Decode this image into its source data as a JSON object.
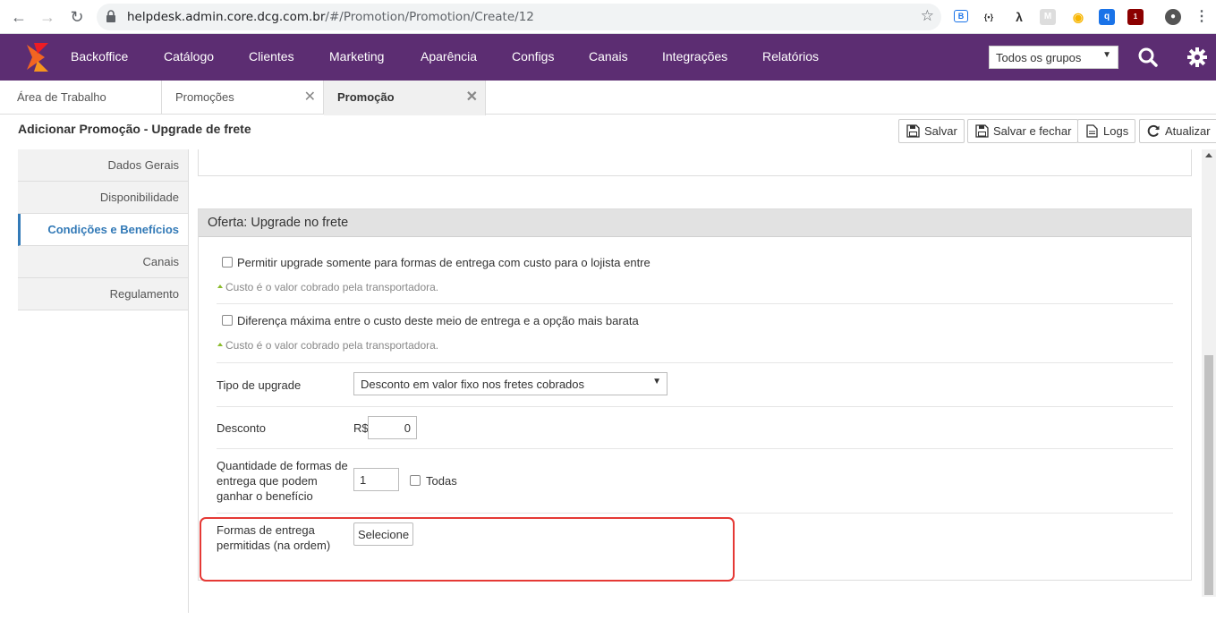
{
  "browser": {
    "url_host": "helpdesk.admin.core.dcg.com.br",
    "url_path": "/#/Promotion/Promotion/Create/12",
    "extension_badge": "1"
  },
  "topnav": {
    "menu": [
      "Backoffice",
      "Catálogo",
      "Clientes",
      "Marketing",
      "Aparência",
      "Configs",
      "Canais",
      "Integrações",
      "Relatórios"
    ],
    "group_select": "Todos os grupos",
    "colors": {
      "background": "#5c2d72",
      "logo_orange": "#f26522"
    }
  },
  "tabs": [
    {
      "label": "Área de Trabalho"
    },
    {
      "label": "Promoções"
    },
    {
      "label": "Promoção"
    }
  ],
  "page": {
    "title": "Adicionar Promoção - Upgrade de frete",
    "buttons": {
      "save": "Salvar",
      "save_close": "Salvar e fechar",
      "logs": "Logs",
      "refresh": "Atualizar"
    }
  },
  "sidebar": {
    "items": [
      "Dados Gerais",
      "Disponibilidade",
      "Condições e Benefícios",
      "Canais",
      "Regulamento"
    ],
    "active": "Condições e Benefícios"
  },
  "panel": {
    "title": "Oferta: Upgrade no frete",
    "checkbox1_label": "Permitir upgrade somente para formas de entrega com custo para o lojista entre",
    "hint1": "Custo é o valor cobrado pela transportadora.",
    "checkbox2_label": "Diferença máxima entre o custo deste meio de entrega e a opção mais barata",
    "hint2": "Custo é o valor cobrado pela transportadora.",
    "upgrade_type_label": "Tipo de upgrade",
    "upgrade_type_value": "Desconto em valor fixo nos fretes cobrados",
    "discount_label": "Desconto",
    "discount_currency": "R$",
    "discount_value": "0",
    "qty_label_line1": "Quantidade de formas de",
    "qty_label_line2": "entrega que podem",
    "qty_label_line3": "ganhar o benefício",
    "qty_value": "1",
    "all_label": "Todas",
    "allowed_label_line1": "Formas de entrega",
    "allowed_label_line2": "permitidas (na ordem)",
    "select_button": "Selecione"
  }
}
